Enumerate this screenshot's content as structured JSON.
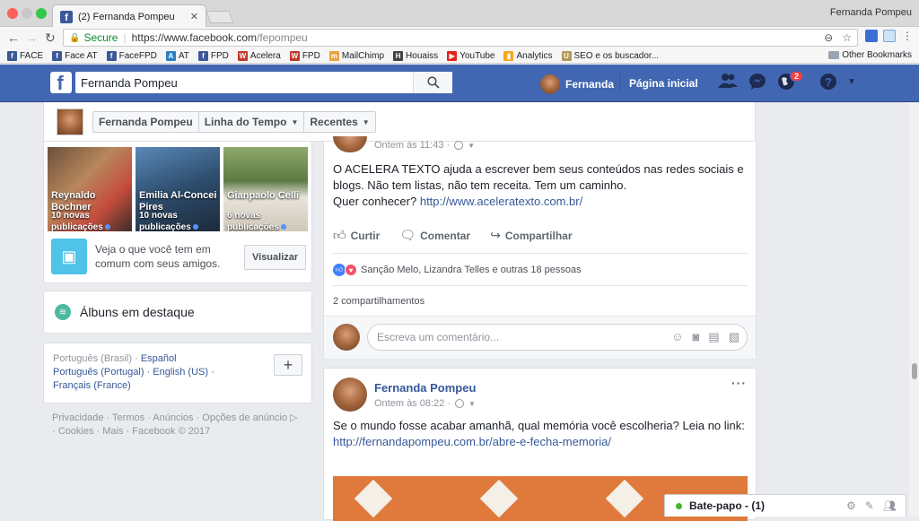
{
  "browser": {
    "tab_title": "(2) Fernanda Pompeu",
    "tab_close": "✕",
    "profile_name": "Fernanda Pompeu",
    "secure_label": "Secure",
    "url_host": "https://www.facebook.com",
    "url_path": "/fepompeu",
    "bookmarks": [
      {
        "label": "FACE",
        "icon": "facebook-icon",
        "color": "#3b5998",
        "glyph": "f"
      },
      {
        "label": "Face AT",
        "icon": "facebook-icon",
        "color": "#3b5998",
        "glyph": "f"
      },
      {
        "label": "FaceFPD",
        "icon": "facebook-icon",
        "color": "#3b5998",
        "glyph": "f"
      },
      {
        "label": "AT",
        "icon": "at-icon",
        "color": "#2a7fc4",
        "glyph": "A"
      },
      {
        "label": "FPD",
        "icon": "page-icon",
        "color": "#3b5998",
        "glyph": "f"
      },
      {
        "label": "Acelera",
        "icon": "wordpress-icon",
        "color": "#c0392b",
        "glyph": "W"
      },
      {
        "label": "FPD",
        "icon": "wordpress-icon",
        "color": "#c0392b",
        "glyph": "W"
      },
      {
        "label": "MailChimp",
        "icon": "mailchimp-icon",
        "color": "#e8a33d",
        "glyph": "m"
      },
      {
        "label": "Houaiss",
        "icon": "houaiss-icon",
        "color": "#444444",
        "glyph": "H"
      },
      {
        "label": "YouTube",
        "icon": "youtube-icon",
        "color": "#e62117",
        "glyph": "▶"
      },
      {
        "label": "Analytics",
        "icon": "analytics-icon",
        "color": "#f5a623",
        "glyph": "▮"
      },
      {
        "label": "SEO e os buscador...",
        "icon": "u-icon",
        "color": "#b39a5a",
        "glyph": "U"
      }
    ],
    "other_bookmarks": "Other Bookmarks"
  },
  "fb_header": {
    "search_value": "Fernanda Pompeu",
    "user_name": "Fernanda",
    "home_label": "Página inicial",
    "notification_count": "2",
    "brand_color": "#4267b2"
  },
  "subheader": {
    "nav": [
      {
        "label": "Fernanda Pompeu"
      },
      {
        "label": "Linha do Tempo"
      },
      {
        "label": "Recentes"
      }
    ]
  },
  "friends": [
    {
      "name": "Reynaldo Bochner",
      "count": "10 novas publicações"
    },
    {
      "name": "Emilia Al-Concei Pires",
      "count": "10 novas publicações"
    },
    {
      "name": "Gianpaolo Celli",
      "count": "6 novas publicações"
    }
  ],
  "compare": {
    "text": "Veja o que você tem em comum com seus amigos.",
    "button": "Visualizar"
  },
  "albums": {
    "label": "Álbuns em destaque"
  },
  "languages": {
    "current": "Português (Brasil) ·",
    "others": [
      "Español",
      "Português (Portugal)",
      "English (US)",
      "Français (France)"
    ],
    "plus": "+"
  },
  "footer": {
    "text": "Privacidade · Termos · Anúncios · Opções de anúncio ▷ · Cookies · Mais · Facebook © 2017"
  },
  "post1": {
    "time": "Ontem às 11:43 ·",
    "text_line1": "O ACELERA TEXTO ajuda a escrever bem seus conteúdos nas redes sociais e blogs. Não tem listas, não tem receita. Tem um caminho.",
    "text_line2_prefix": "Quer conhecer? ",
    "link": "http://www.aceleratexto.com.br/",
    "actions": {
      "like": "Curtir",
      "comment": "Comentar",
      "share": "Compartilhar"
    },
    "reactions_text": "Sanção Melo, Lizandra Telles e outras 18 pessoas",
    "shares": "2 compartilhamentos",
    "comment_placeholder": "Escreva um comentário..."
  },
  "post2": {
    "author": "Fernanda Pompeu",
    "time": "Ontem às 08:22 ·",
    "text": "Se o mundo fosse acabar amanhã, qual memória você escolheria? Leia no link:",
    "link": "http://fernandapompeu.com.br/abre-e-fecha-memoria/",
    "more": "···"
  },
  "chat": {
    "label": "Bate-papo - (1)"
  }
}
